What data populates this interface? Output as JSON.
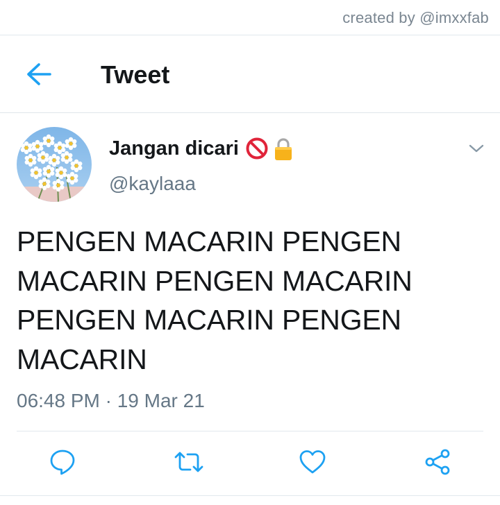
{
  "watermark": "created by @imxxfab",
  "header": {
    "title": "Tweet",
    "back_icon": "arrow-left-icon"
  },
  "tweet": {
    "display_name": "Jangan dicari",
    "name_emojis": [
      "no-entry-emoji",
      "lock-emoji"
    ],
    "handle": "@kaylaaa",
    "text": "PENGEN MACARIN PENGEN MACARIN PENGEN MACARIN PENGEN MACARIN PENGEN MACARIN",
    "timestamp": "06:48 PM · 19 Mar 21"
  },
  "actions": [
    "reply-icon",
    "retweet-icon",
    "like-icon",
    "share-icon"
  ],
  "colors": {
    "accent": "#1da1f2",
    "secondary_text": "#657786",
    "primary_text": "#14171a",
    "divider": "#e1e8ed"
  }
}
